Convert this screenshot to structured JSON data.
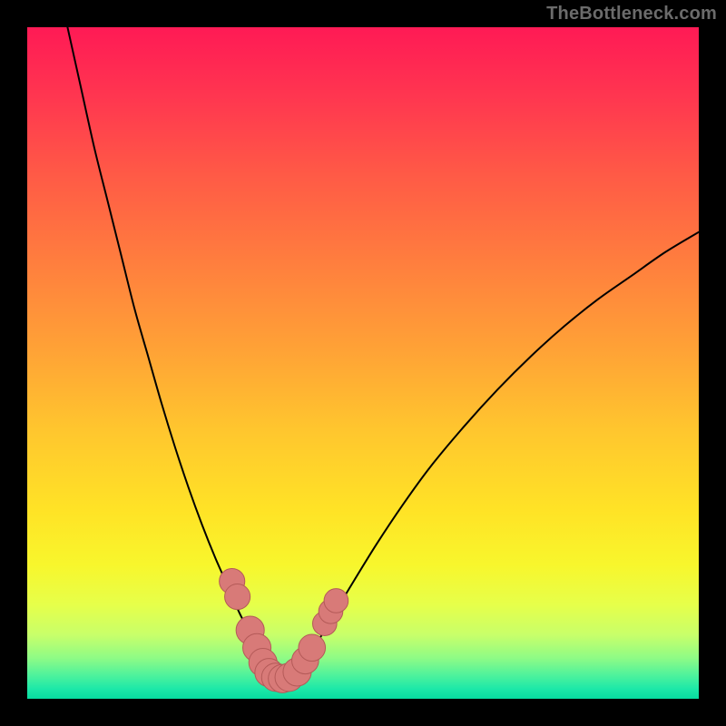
{
  "watermark": "TheBottleneck.com",
  "colors": {
    "bg": "#000000",
    "curve": "#000000",
    "marker_fill": "#d87a78",
    "marker_stroke": "#b45a58",
    "grad_stops": [
      {
        "o": 0.0,
        "c": "#ff1a55"
      },
      {
        "o": 0.1,
        "c": "#ff3550"
      },
      {
        "o": 0.22,
        "c": "#ff5a46"
      },
      {
        "o": 0.35,
        "c": "#ff7e3e"
      },
      {
        "o": 0.48,
        "c": "#ffa236"
      },
      {
        "o": 0.6,
        "c": "#ffc62e"
      },
      {
        "o": 0.72,
        "c": "#ffe326"
      },
      {
        "o": 0.8,
        "c": "#f8f62c"
      },
      {
        "o": 0.86,
        "c": "#e6ff4a"
      },
      {
        "o": 0.905,
        "c": "#c8ff6a"
      },
      {
        "o": 0.94,
        "c": "#8dfb86"
      },
      {
        "o": 0.965,
        "c": "#4ef29c"
      },
      {
        "o": 0.985,
        "c": "#1de8a8"
      },
      {
        "o": 1.0,
        "c": "#07dca0"
      }
    ]
  },
  "chart_data": {
    "type": "line",
    "title": "",
    "xlabel": "",
    "ylabel": "",
    "xlim": [
      0,
      100
    ],
    "ylim": [
      0,
      100
    ],
    "grid": false,
    "legend": false,
    "series": [
      {
        "name": "left-branch",
        "x": [
          6,
          8,
          10,
          12,
          14,
          16,
          18,
          20,
          22,
          24,
          26,
          28,
          30,
          31.5,
          33,
          34,
          35,
          35.8
        ],
        "y": [
          100,
          91,
          82,
          74,
          66,
          58,
          51,
          44,
          37.5,
          31.5,
          26,
          21,
          16.5,
          13,
          10,
          7.5,
          5.5,
          4
        ]
      },
      {
        "name": "right-branch",
        "x": [
          40.5,
          41.5,
          43,
          45,
          48,
          52,
          56,
          60,
          65,
          70,
          75,
          80,
          85,
          90,
          95,
          100
        ],
        "y": [
          4,
          5.5,
          8,
          11.5,
          16.5,
          23,
          29,
          34.5,
          40.5,
          46,
          51,
          55.5,
          59.5,
          63,
          66.5,
          69.5
        ]
      },
      {
        "name": "valley-floor",
        "x": [
          35.8,
          36.6,
          37.6,
          38.6,
          39.6,
          40.5
        ],
        "y": [
          4,
          3.2,
          3,
          3,
          3.2,
          4
        ]
      }
    ],
    "markers": [
      {
        "name": "left-upper-pair-a",
        "x": 30.5,
        "y": 17.5,
        "r": 1.9
      },
      {
        "name": "left-upper-pair-b",
        "x": 31.3,
        "y": 15.2,
        "r": 1.9
      },
      {
        "name": "left-lower-a",
        "x": 33.2,
        "y": 10.2,
        "r": 2.1
      },
      {
        "name": "left-lower-b",
        "x": 34.2,
        "y": 7.6,
        "r": 2.1
      },
      {
        "name": "left-lower-c",
        "x": 35.1,
        "y": 5.4,
        "r": 2.1
      },
      {
        "name": "floor-a",
        "x": 36.0,
        "y": 3.9,
        "r": 2.1
      },
      {
        "name": "floor-b",
        "x": 37.0,
        "y": 3.2,
        "r": 2.1
      },
      {
        "name": "floor-c",
        "x": 38.0,
        "y": 3.0,
        "r": 2.1
      },
      {
        "name": "floor-d",
        "x": 39.0,
        "y": 3.2,
        "r": 2.1
      },
      {
        "name": "floor-e",
        "x": 40.2,
        "y": 4.0,
        "r": 2.1
      },
      {
        "name": "right-lower-a",
        "x": 41.4,
        "y": 5.7,
        "r": 2.0
      },
      {
        "name": "right-lower-b",
        "x": 42.4,
        "y": 7.6,
        "r": 2.0
      },
      {
        "name": "right-upper-a",
        "x": 44.3,
        "y": 11.2,
        "r": 1.8
      },
      {
        "name": "right-upper-b",
        "x": 45.2,
        "y": 13.0,
        "r": 1.8
      },
      {
        "name": "right-upper-c",
        "x": 46.0,
        "y": 14.6,
        "r": 1.8
      }
    ]
  }
}
